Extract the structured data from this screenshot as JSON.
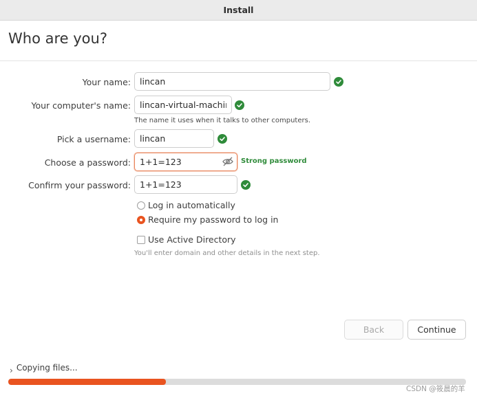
{
  "window": {
    "title": "Install"
  },
  "heading": "Who are you?",
  "form": {
    "name": {
      "label": "Your name:",
      "value": "lincan"
    },
    "computer": {
      "label": "Your computer's name:",
      "value": "lincan-virtual-machine",
      "hint": "The name it uses when it talks to other computers."
    },
    "username": {
      "label": "Pick a username:",
      "value": "lincan"
    },
    "password": {
      "label": "Choose a password:",
      "value": "1+1=123",
      "strength": "Strong password"
    },
    "confirm": {
      "label": "Confirm your password:",
      "value": "1+1=123"
    }
  },
  "login_options": {
    "auto": {
      "label": "Log in automatically",
      "selected": false
    },
    "require": {
      "label": "Require my password to log in",
      "selected": true
    }
  },
  "active_directory": {
    "label": "Use Active Directory",
    "checked": false,
    "hint": "You'll enter domain and other details in the next step."
  },
  "buttons": {
    "back": "Back",
    "continue": "Continue"
  },
  "status": {
    "text": "Copying files...",
    "progress": 0.345
  },
  "watermark": "CSDN @筱晨的羊",
  "colors": {
    "accent": "#e95420",
    "ok": "#2f8b3a"
  },
  "icons": {
    "ok": "check-circle-icon",
    "eye": "eye-slash-icon",
    "expander": "chevron-right-icon"
  }
}
